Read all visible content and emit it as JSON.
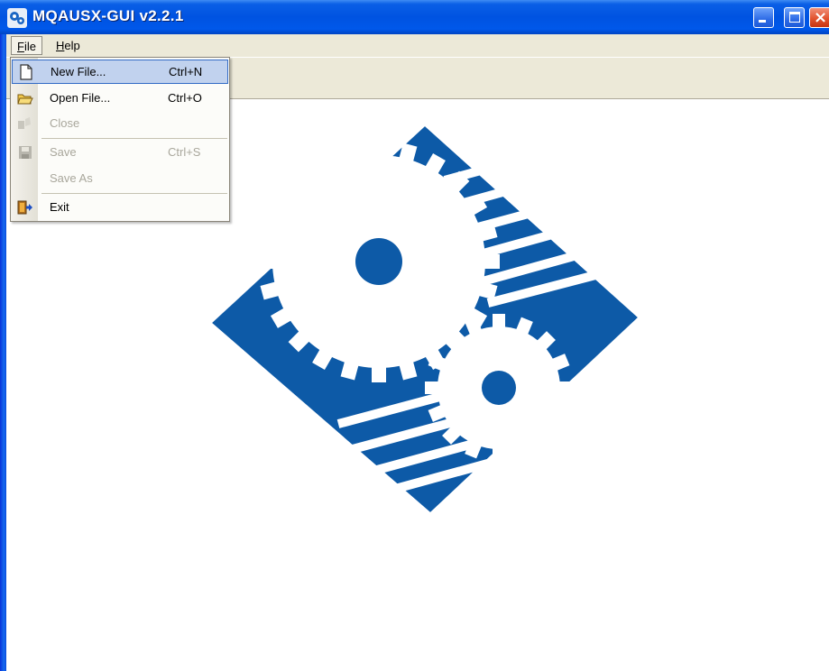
{
  "window": {
    "title": "MQAUSX-GUI v2.2.1"
  },
  "menubar": {
    "file": {
      "prefix": "F",
      "rest": "ile"
    },
    "help": {
      "prefix": "H",
      "rest": "elp"
    }
  },
  "file_menu": {
    "items": [
      {
        "label": "New File...",
        "shortcut": "Ctrl+N",
        "icon": "new-file-icon",
        "state": "highlighted"
      },
      {
        "label": "Open File...",
        "shortcut": "Ctrl+O",
        "icon": "open-folder-icon",
        "state": "enabled"
      },
      {
        "label": "Close",
        "shortcut": "",
        "icon": "close-file-icon",
        "state": "disabled"
      },
      {
        "label": "Save",
        "shortcut": "Ctrl+S",
        "icon": "save-disk-icon",
        "state": "disabled"
      },
      {
        "label": "Save As",
        "shortcut": "",
        "icon": "",
        "state": "disabled"
      },
      {
        "label": "Exit",
        "shortcut": "",
        "icon": "exit-door-icon",
        "state": "enabled"
      }
    ]
  },
  "colors": {
    "logo_blue": "#0d5aa7",
    "titlebar_blue": "#0053e1",
    "menu_highlight": "#c1d2ee"
  },
  "logo": {
    "icon": "gears-logo-icon"
  }
}
